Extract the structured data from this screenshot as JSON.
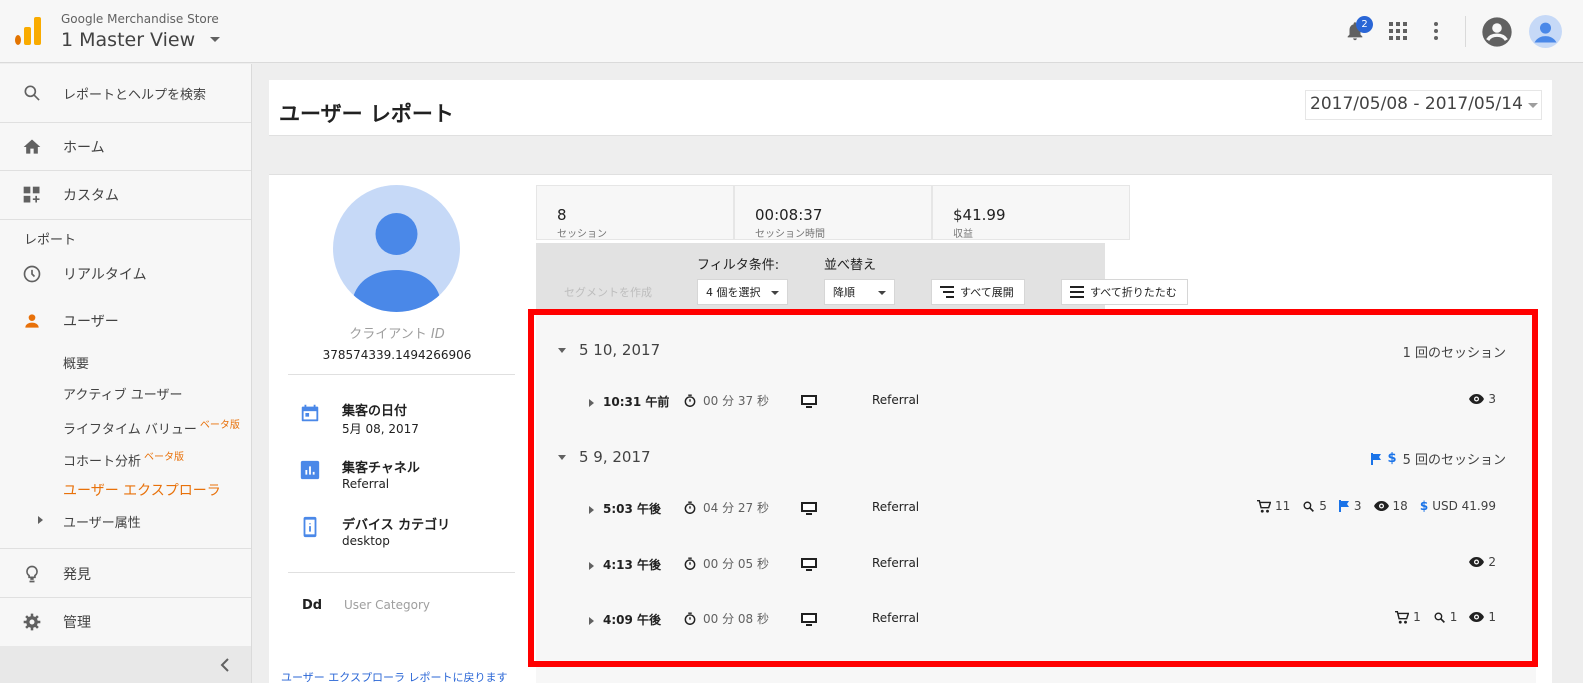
{
  "header": {
    "store": "Google Merchandise Store",
    "view": "1 Master View",
    "notifications": "2",
    "brand_colors": [
      "#f9ab00",
      "#e37400"
    ]
  },
  "sidebar": {
    "search": "レポートとヘルプを検索",
    "home": "ホーム",
    "custom": "カスタム",
    "reports_section": "レポート",
    "realtime": "リアルタイム",
    "users": "ユーザー",
    "sub_items": [
      "概要",
      "アクティブ ユーザー",
      "ライフタイム バリュー",
      "コホート分析",
      "ユーザー エクスプローラ",
      "ユーザー属性"
    ],
    "beta": "ベータ版",
    "discover": "発見",
    "admin": "管理"
  },
  "page": {
    "title": "ユーザー レポート",
    "date_range": "2017/05/08 - 2017/05/14"
  },
  "profile": {
    "client_label": "クライアント",
    "client_id_label": "ID",
    "client_id": "378574339.1494266906",
    "acq_date_label": "集客の日付",
    "acq_date": "5月 08, 2017",
    "acq_channel_label": "集客チャネル",
    "acq_channel": "Referral",
    "device_label": "デバイス カテゴリ",
    "device": "desktop",
    "dd": "Dd",
    "user_category": "User Category",
    "back_link": "ユーザー エクスプローラ レポートに戻ります"
  },
  "stats": [
    {
      "value": "8",
      "label": "セッション"
    },
    {
      "value": "00:08:37",
      "label": "セッション時間"
    },
    {
      "value": "$41.99",
      "label": "収益"
    }
  ],
  "toolbar": {
    "segment": "セグメントを作成",
    "filter_label": "フィルタ条件:",
    "filter_value": "4 個を選択",
    "sort_label": "並べ替え",
    "sort_value": "降順",
    "expand": "すべて展開",
    "collapse": "すべて折りたたむ"
  },
  "sessions": {
    "day1": {
      "date": "5 10, 2017",
      "count": "1 回のセッション"
    },
    "day2": {
      "date": "5 9, 2017",
      "count": "5 回のセッション"
    },
    "rows": [
      {
        "time": "10:31 午前",
        "duration": "00 分 37 秒",
        "channel": "Referral",
        "views": "3"
      },
      {
        "time": "5:03 午後",
        "duration": "04 分 27 秒",
        "channel": "Referral",
        "cart": "11",
        "search": "5",
        "goal": "3",
        "views": "18",
        "revenue": "USD 41.99"
      },
      {
        "time": "4:13 午後",
        "duration": "00 分 05 秒",
        "channel": "Referral",
        "views": "2"
      },
      {
        "time": "4:09 午後",
        "duration": "00 分 08 秒",
        "channel": "Referral",
        "cart": "1",
        "search": "1",
        "views": "1"
      }
    ]
  },
  "colors": {
    "accent": "#e8710a",
    "highlight": "#ff0000",
    "link": "#1a73e8"
  }
}
